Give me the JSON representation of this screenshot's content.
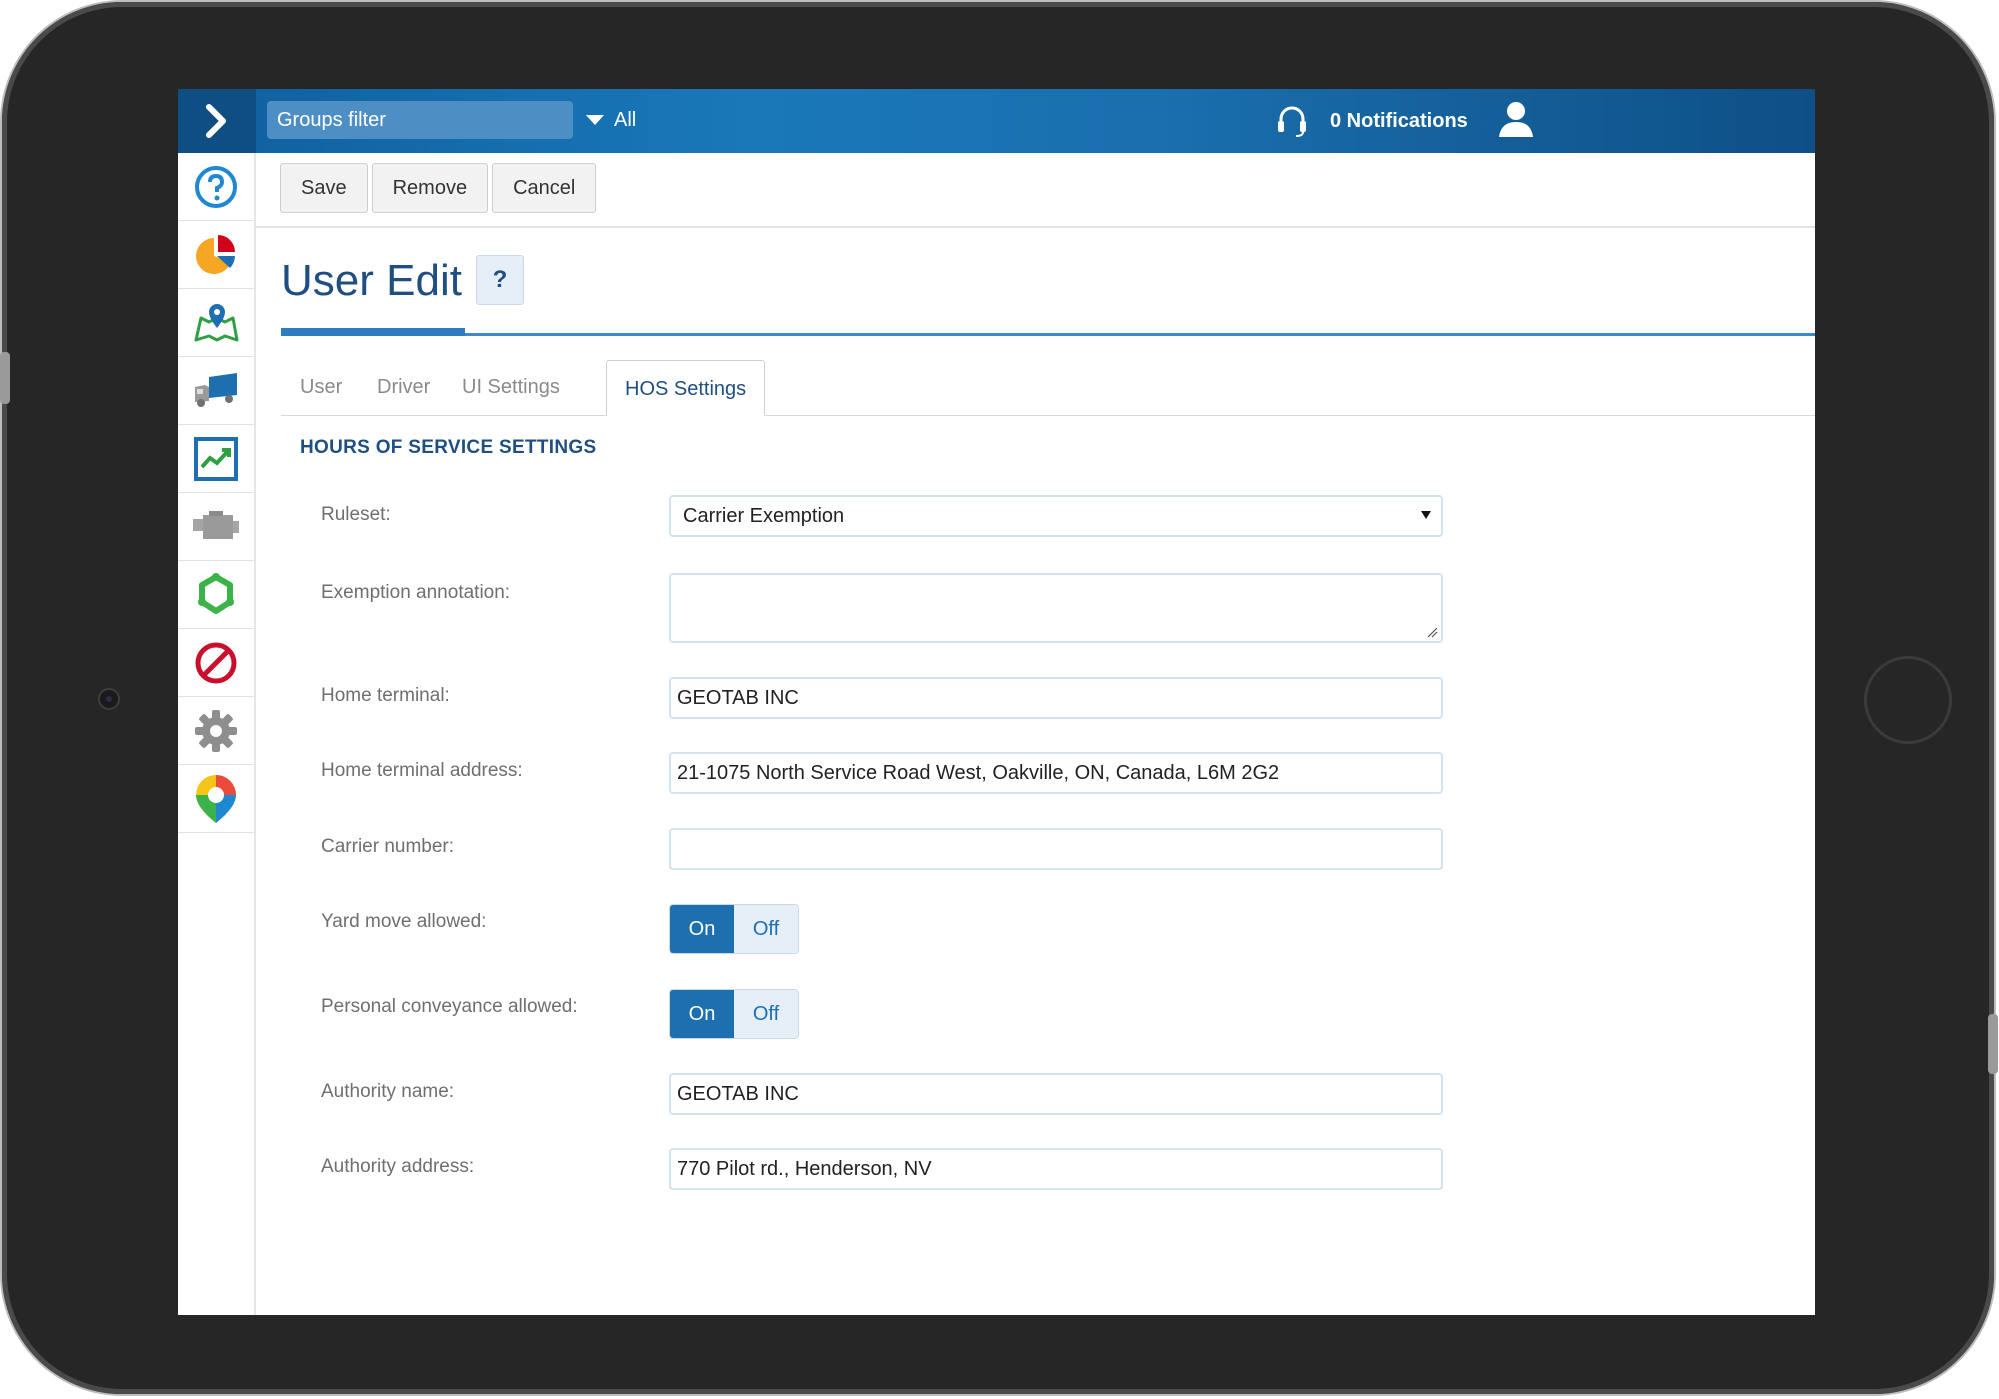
{
  "topbar": {
    "groups_filter_placeholder": "Groups filter",
    "group_scope": "All",
    "notifications": "0 Notifications"
  },
  "sidebar": {
    "items": [
      {
        "icon": "help-icon"
      },
      {
        "icon": "pie-chart-icon"
      },
      {
        "icon": "map-icon"
      },
      {
        "icon": "truck-icon"
      },
      {
        "icon": "activity-chart-icon"
      },
      {
        "icon": "engine-icon"
      },
      {
        "icon": "rules-icon"
      },
      {
        "icon": "exceptions-icon"
      },
      {
        "icon": "settings-gear-icon"
      },
      {
        "icon": "marketplace-icon"
      }
    ]
  },
  "toolbar": {
    "save_label": "Save",
    "remove_label": "Remove",
    "cancel_label": "Cancel"
  },
  "page": {
    "title": "User Edit",
    "help_badge": "?"
  },
  "tabs": [
    {
      "label": "User",
      "active": false
    },
    {
      "label": "Driver",
      "active": false
    },
    {
      "label": "UI Settings",
      "active": false
    },
    {
      "label": "HOS Settings",
      "active": true
    }
  ],
  "section": {
    "heading": "HOURS OF SERVICE SETTINGS"
  },
  "form": {
    "ruleset": {
      "label": "Ruleset:",
      "value": "Carrier Exemption"
    },
    "exemption_annotation": {
      "label": "Exemption annotation:",
      "value": ""
    },
    "home_terminal": {
      "label": "Home terminal:",
      "value": "GEOTAB INC"
    },
    "home_terminal_address": {
      "label": "Home terminal address:",
      "value": "21-1075 North Service Road West, Oakville, ON, Canada, L6M 2G2"
    },
    "carrier_number": {
      "label": "Carrier number:",
      "value": ""
    },
    "yard_move": {
      "label": "Yard move allowed:",
      "on_label": "On",
      "off_label": "Off",
      "state": "On"
    },
    "personal_conveyance": {
      "label": "Personal conveyance allowed:",
      "on_label": "On",
      "off_label": "Off",
      "state": "On"
    },
    "authority_name": {
      "label": "Authority name:",
      "value": "GEOTAB INC"
    },
    "authority_address": {
      "label": "Authority address:",
      "value": "770 Pilot rd., Henderson, NV"
    }
  },
  "colors": {
    "topbar": "#1a6fae",
    "accent": "#1e6fb0",
    "title": "#1f4f82",
    "bezel": "#262626"
  }
}
